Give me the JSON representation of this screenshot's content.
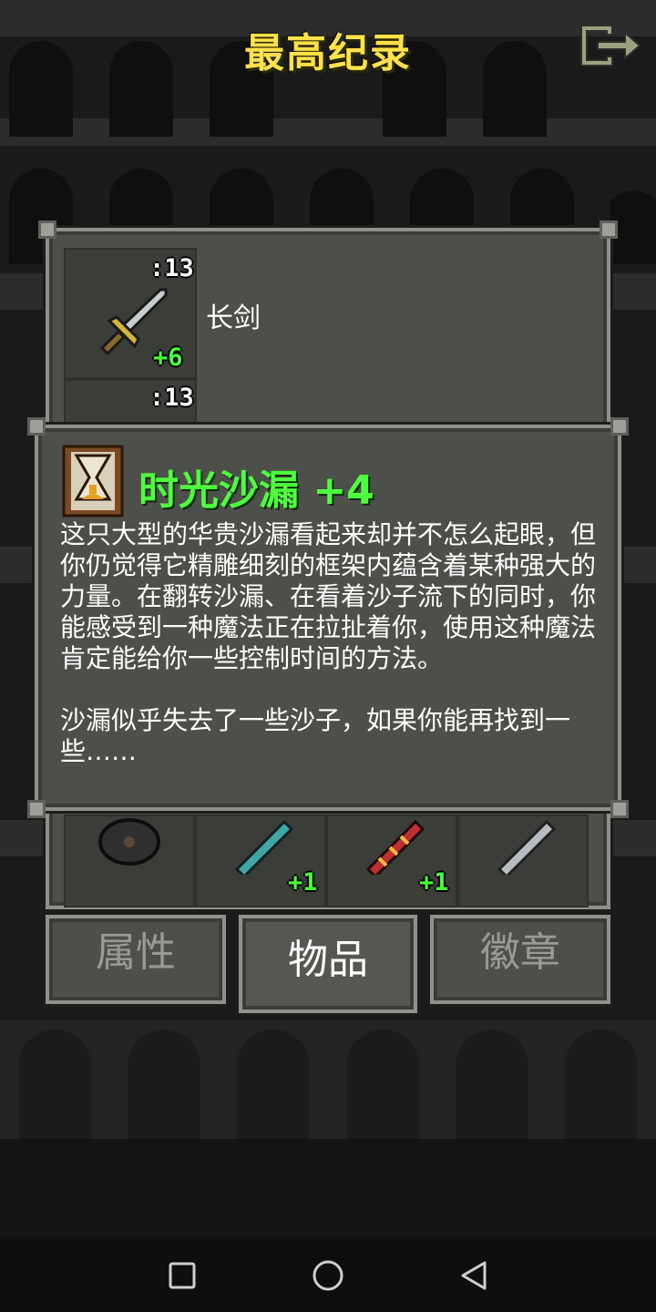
{
  "header": {
    "title": "最高纪录",
    "exit_icon": "exit-icon"
  },
  "rankings": {
    "entries": [
      {
        "name": "长剑",
        "count": ":13",
        "bonus": "+6",
        "icon": "longsword-icon"
      },
      {
        "name": "",
        "count": ":13",
        "bonus": "",
        "icon": ""
      }
    ],
    "items_row": [
      {
        "icon": "round-shield-icon",
        "bonus": ""
      },
      {
        "icon": "teal-wand-icon",
        "bonus": "+1"
      },
      {
        "icon": "fire-wand-icon",
        "bonus": "+1"
      },
      {
        "icon": "steel-wand-icon",
        "bonus": ""
      }
    ]
  },
  "info": {
    "icon": "hourglass-icon",
    "title": "时光沙漏 +4",
    "description": "这只大型的华贵沙漏看起来却并不怎么起眼，但你仍觉得它精雕细刻的框架内蕴含着某种强大的力量。在翻转沙漏、在看着沙子流下的同时，你能感受到一种魔法正在拉扯着你，使用这种魔法肯定能给你一些控制时间的方法。\n\n沙漏似乎失去了一些沙子，如果你能再找到一些……"
  },
  "tabs": [
    {
      "label": "属性",
      "active": false
    },
    {
      "label": "物品",
      "active": true
    },
    {
      "label": "徽章",
      "active": false
    }
  ],
  "navbar": {
    "icons": [
      "recents-square-icon",
      "home-circle-icon",
      "back-triangle-icon"
    ]
  }
}
